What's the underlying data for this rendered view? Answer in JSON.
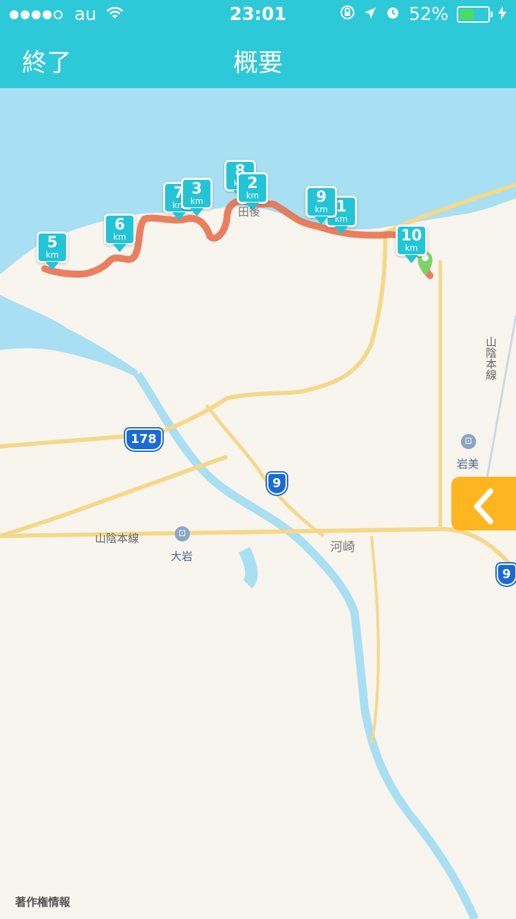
{
  "status_bar": {
    "carrier": "au",
    "time": "23:01",
    "battery_percent": "52%",
    "battery_level": 0.52,
    "signal_dots_filled": 4,
    "icons": [
      "wifi-icon",
      "rotation-lock-icon",
      "location-arrow-icon",
      "alarm-icon",
      "charging-icon"
    ]
  },
  "nav": {
    "left_label": "終了",
    "title": "概要"
  },
  "map": {
    "route_color": "#e8724f",
    "km_markers": [
      {
        "label": "5",
        "unit": "km"
      },
      {
        "label": "6",
        "unit": "km"
      },
      {
        "label": "7",
        "unit": "km"
      },
      {
        "label": "3",
        "unit": "km"
      },
      {
        "label": "8",
        "unit": "km"
      },
      {
        "label": "2",
        "unit": "km"
      },
      {
        "label": "9",
        "unit": "km"
      },
      {
        "label": "1",
        "unit": "km"
      },
      {
        "label": "10",
        "unit": "km"
      }
    ],
    "road_shields": [
      "178",
      "9",
      "9"
    ],
    "place_labels": {
      "railway": "山陰本線",
      "railway_vertical": "山陰本線",
      "station_oiwa": "大岩",
      "station_iwami": "岩美",
      "town_kawasaki": "河崎",
      "town_north": "田後"
    },
    "copyright": "著作権情報"
  },
  "panel_toggle": {
    "icon": "chevron-left-icon",
    "color": "#ffb51f"
  }
}
